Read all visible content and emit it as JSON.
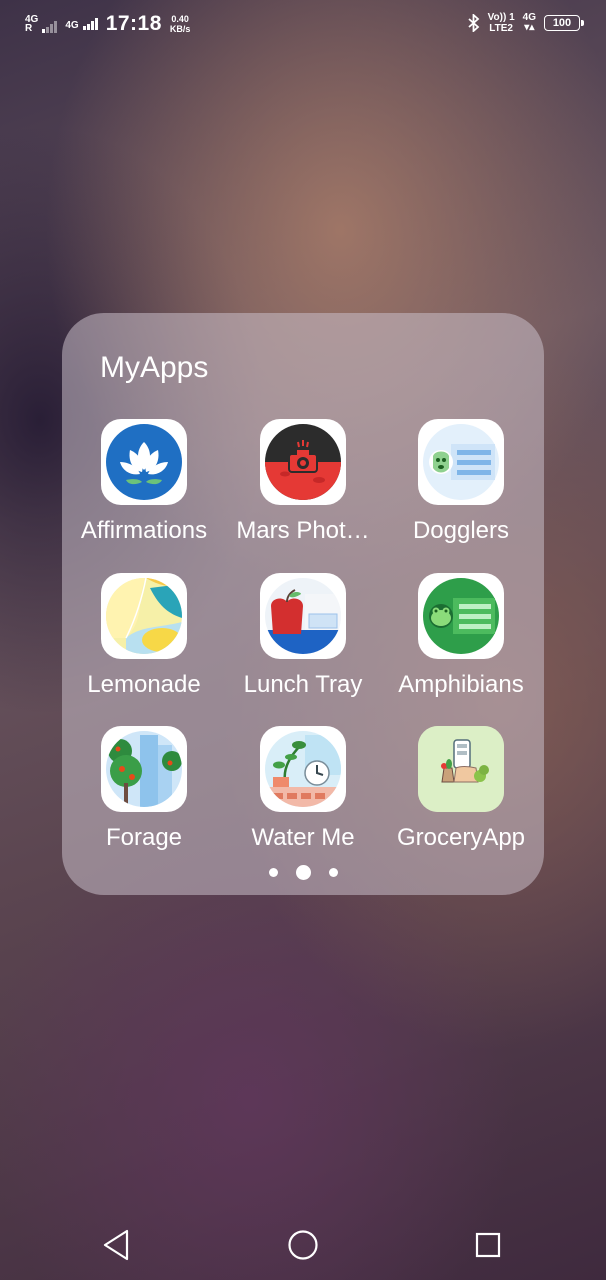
{
  "status_bar": {
    "sim1_tag_top": "4G",
    "sim1_tag_bottom": "R",
    "sim2_tag": "4G",
    "time": "17:18",
    "speed_value": "0.40",
    "speed_unit": "KB/s",
    "volte_top": "Vo))",
    "volte_sim": "1",
    "volte_bottom": "LTE2",
    "net_type": "4G",
    "battery": "100"
  },
  "folder": {
    "title": "MyApps",
    "apps": [
      {
        "label": "Affirmations",
        "icon": "lotus-icon"
      },
      {
        "label": "Mars Phot…",
        "icon": "mars-camera-icon"
      },
      {
        "label": "Dogglers",
        "icon": "dog-list-icon"
      },
      {
        "label": "Lemonade",
        "icon": "lemon-icon"
      },
      {
        "label": "Lunch Tray",
        "icon": "apple-tray-icon"
      },
      {
        "label": "Amphibians",
        "icon": "frog-list-icon"
      },
      {
        "label": "Forage",
        "icon": "forest-icon"
      },
      {
        "label": "Water Me",
        "icon": "plant-clock-icon"
      },
      {
        "label": "GroceryApp",
        "icon": "grocery-icon"
      }
    ],
    "pages": 3,
    "active_page": 2
  },
  "navbar": {
    "back": "back-icon",
    "home": "home-icon",
    "recents": "recents-icon"
  }
}
